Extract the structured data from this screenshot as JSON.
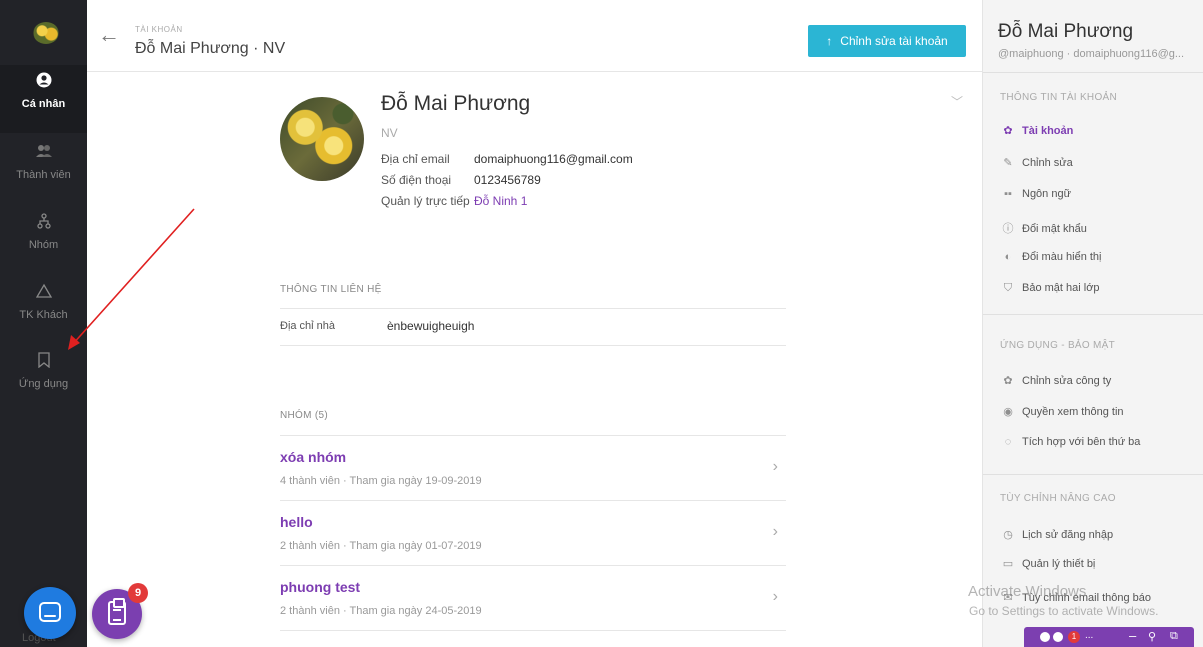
{
  "sidebar": {
    "items": [
      {
        "label": "Cá nhân",
        "icon": "user-circle-icon"
      },
      {
        "label": "Thành viên",
        "icon": "members-icon"
      },
      {
        "label": "Nhóm",
        "icon": "hierarchy-icon"
      },
      {
        "label": "TK Khách",
        "icon": "triangle-icon"
      },
      {
        "label": "Ứng dụng",
        "icon": "bookmark-icon"
      }
    ],
    "logout": "Logout",
    "task_badge": "9"
  },
  "header": {
    "breadcrumb": "TÀI KHOẢN",
    "title": "Đỗ Mai Phương · NV",
    "edit_button": "Chỉnh sửa tài khoản"
  },
  "profile": {
    "name": "Đỗ Mai Phương",
    "role": "NV",
    "fields": [
      {
        "label": "Địa chỉ email",
        "value": "domaiphuong116@gmail.com"
      },
      {
        "label": "Số điện thoại",
        "value": "0123456789"
      },
      {
        "label": "Quản lý trực tiếp",
        "value": "Đỗ Ninh 1"
      }
    ]
  },
  "contact": {
    "section_title": "THÔNG TIN LIÊN HỆ",
    "address_label": "Địa chỉ nhà",
    "address_value": "ènbewuigheuigh"
  },
  "groups": {
    "section_title": "NHÓM (5)",
    "items": [
      {
        "name": "xóa nhóm",
        "meta": "4 thành viên · Tham gia ngày 19-09-2019"
      },
      {
        "name": "hello",
        "meta": "2 thành viên · Tham gia ngày 01-07-2019"
      },
      {
        "name": "phuong test",
        "meta": "2 thành viên · Tham gia ngày 24-05-2019"
      }
    ]
  },
  "right_panel": {
    "name": "Đỗ Mai Phương",
    "handle": "@maiphuong · domaiphuong116@g...",
    "sections": [
      {
        "title": "THÔNG TIN TÀI KHOẢN",
        "items": [
          {
            "label": "Tài khoản",
            "icon": "gear-icon"
          },
          {
            "label": "Chỉnh sửa",
            "icon": "pencil-icon"
          },
          {
            "label": "Ngôn ngữ",
            "icon": "language-icon"
          },
          {
            "label": "Đổi mật khẩu",
            "icon": "info-icon"
          },
          {
            "label": "Đổi màu hiển thị",
            "icon": "palette-icon"
          },
          {
            "label": "Bảo mật hai lớp",
            "icon": "shield-icon"
          }
        ]
      },
      {
        "title": "ỨNG DỤNG - BẢO MẬT",
        "items": [
          {
            "label": "Chỉnh sửa công ty",
            "icon": "gear-icon"
          },
          {
            "label": "Quyền xem thông tin",
            "icon": "eye-icon"
          },
          {
            "label": "Tích hợp với bên thứ ba",
            "icon": "globe-icon"
          }
        ]
      },
      {
        "title": "TÙY CHỈNH NÂNG CAO",
        "items": [
          {
            "label": "Lịch sử đăng nhập",
            "icon": "clock-icon"
          },
          {
            "label": "Quản lý thiết bị",
            "icon": "monitor-icon"
          },
          {
            "label": "Tùy chỉnh email thông báo",
            "icon": "mail-icon"
          }
        ]
      }
    ]
  },
  "watermark": {
    "line1": "Activate Windows",
    "line2": "Go to Settings to activate Windows."
  },
  "float_bar": {
    "badge": "1",
    "dots": "..."
  },
  "colors": {
    "accent_purple": "#7d3db2",
    "button_cyan": "#2bb5d4",
    "sidebar_dark": "#222328",
    "annotation_red": "#e02020"
  }
}
